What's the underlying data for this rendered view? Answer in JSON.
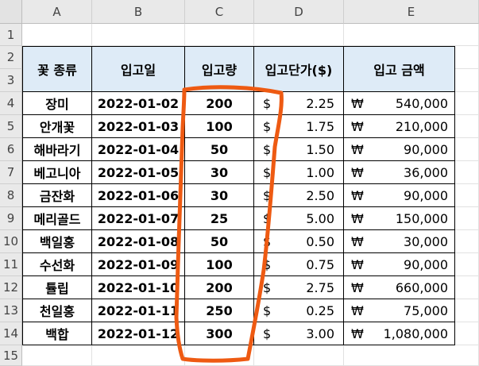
{
  "columns": [
    "A",
    "B",
    "C",
    "D",
    "E"
  ],
  "rows": [
    "1",
    "2",
    "3",
    "4",
    "5",
    "6",
    "7",
    "8",
    "9",
    "10",
    "11",
    "12",
    "13",
    "14",
    "15"
  ],
  "headers": {
    "flower_type": "꽃 종류",
    "date": "입고일",
    "quantity": "입고량",
    "unit_price": "입고단가($)",
    "amount": "입고 금액"
  },
  "currency": {
    "dollar": "$",
    "won": "₩"
  },
  "records": [
    {
      "flower": "장미",
      "date": "2022-01-02",
      "qty": "200",
      "price": "2.25",
      "amount": "540,000"
    },
    {
      "flower": "안개꽃",
      "date": "2022-01-03",
      "qty": "100",
      "price": "1.75",
      "amount": "210,000"
    },
    {
      "flower": "해바라기",
      "date": "2022-01-04",
      "qty": "50",
      "price": "1.50",
      "amount": "90,000"
    },
    {
      "flower": "베고니아",
      "date": "2022-01-05",
      "qty": "30",
      "price": "1.00",
      "amount": "36,000"
    },
    {
      "flower": "금잔화",
      "date": "2022-01-06",
      "qty": "30",
      "price": "2.50",
      "amount": "90,000"
    },
    {
      "flower": "메리골드",
      "date": "2022-01-07",
      "qty": "25",
      "price": "5.00",
      "amount": "150,000"
    },
    {
      "flower": "백일홍",
      "date": "2022-01-08",
      "qty": "50",
      "price": "0.50",
      "amount": "30,000"
    },
    {
      "flower": "수선화",
      "date": "2022-01-09",
      "qty": "100",
      "price": "0.75",
      "amount": "90,000"
    },
    {
      "flower": "튤립",
      "date": "2022-01-10",
      "qty": "200",
      "price": "2.75",
      "amount": "660,000"
    },
    {
      "flower": "천일홍",
      "date": "2022-01-11",
      "qty": "250",
      "price": "0.25",
      "amount": "75,000"
    },
    {
      "flower": "백합",
      "date": "2022-01-12",
      "qty": "300",
      "price": "3.00",
      "amount": "1,080,000"
    }
  ],
  "colors": {
    "header_fill": "#deebf7",
    "marker": "#ee5a12"
  }
}
